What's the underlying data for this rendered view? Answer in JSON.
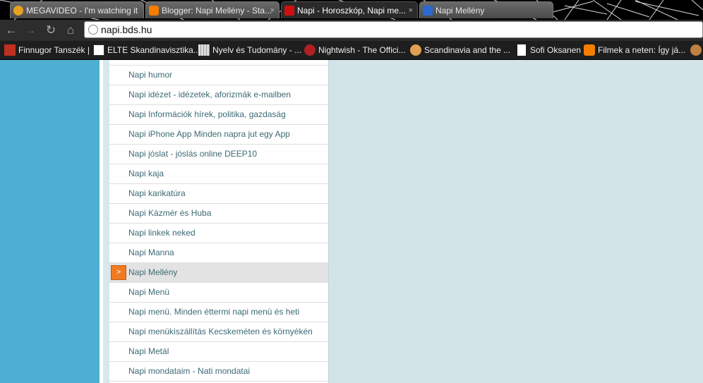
{
  "tabs": [
    {
      "label": "MEGAVIDEO - I'm watching it",
      "icon": "megavideo-icon",
      "active": false
    },
    {
      "label": "Blogger: Napi Mellény - Sta...",
      "icon": "blogger-icon",
      "active": false,
      "close": "×"
    },
    {
      "label": "Napi - Horoszkóp, Napi me...",
      "icon": "napi-site-icon",
      "active": true,
      "close": "×"
    },
    {
      "label": "Napi Mellény",
      "icon": "star-bookmark-icon",
      "active": false
    }
  ],
  "toolbar": {
    "back": "←",
    "forward": "→",
    "reload": "↻",
    "home": "⌂",
    "url": "napi.bds.hu"
  },
  "bookmarks": [
    {
      "label": "Finnugor Tanszék |",
      "icon": "finnugor-icon"
    },
    {
      "label": "ELTE Skandinavisztika...",
      "icon": "elte-sx-icon"
    },
    {
      "label": "Nyelv és Tudomány - ...",
      "icon": "grid-icon"
    },
    {
      "label": "Nightwish - The Offici...",
      "icon": "nightwish-icon"
    },
    {
      "label": "Scandinavia and the ...",
      "icon": "scandinavia-icon"
    },
    {
      "label": "Sofi Oksanen",
      "icon": "page-icon"
    },
    {
      "label": "Filmek a neten: Így já...",
      "icon": "blogger-icon"
    }
  ],
  "list": {
    "items": [
      "Napi humor",
      "Napi idézet - idézetek, aforizmák e-mailben",
      "Napi Információk hírek, politika, gazdaság",
      "Napi iPhone App Minden napra jut egy App",
      "Napi jóslat - jóslás online DEEP10",
      "Napi kaja",
      "Napi karikatúra",
      "Napi Kázmér és Huba",
      "Napi linkek neked",
      "Napi Manna",
      "Napi Mellény",
      "Napi Menü",
      "Napi menü. Minden éttermi napi menü és heti",
      "Napi menükiszállítás Kecskeméten és környékén",
      "Napi Metál",
      "Napi mondataim - Nati mondatai"
    ],
    "selected_index": 10,
    "arrow": ">"
  },
  "colors": {
    "left_bar": "#4fafd3",
    "page_bg": "#d2e4e8",
    "link_text": "#3c6a74",
    "arrow": "#f07a22"
  }
}
